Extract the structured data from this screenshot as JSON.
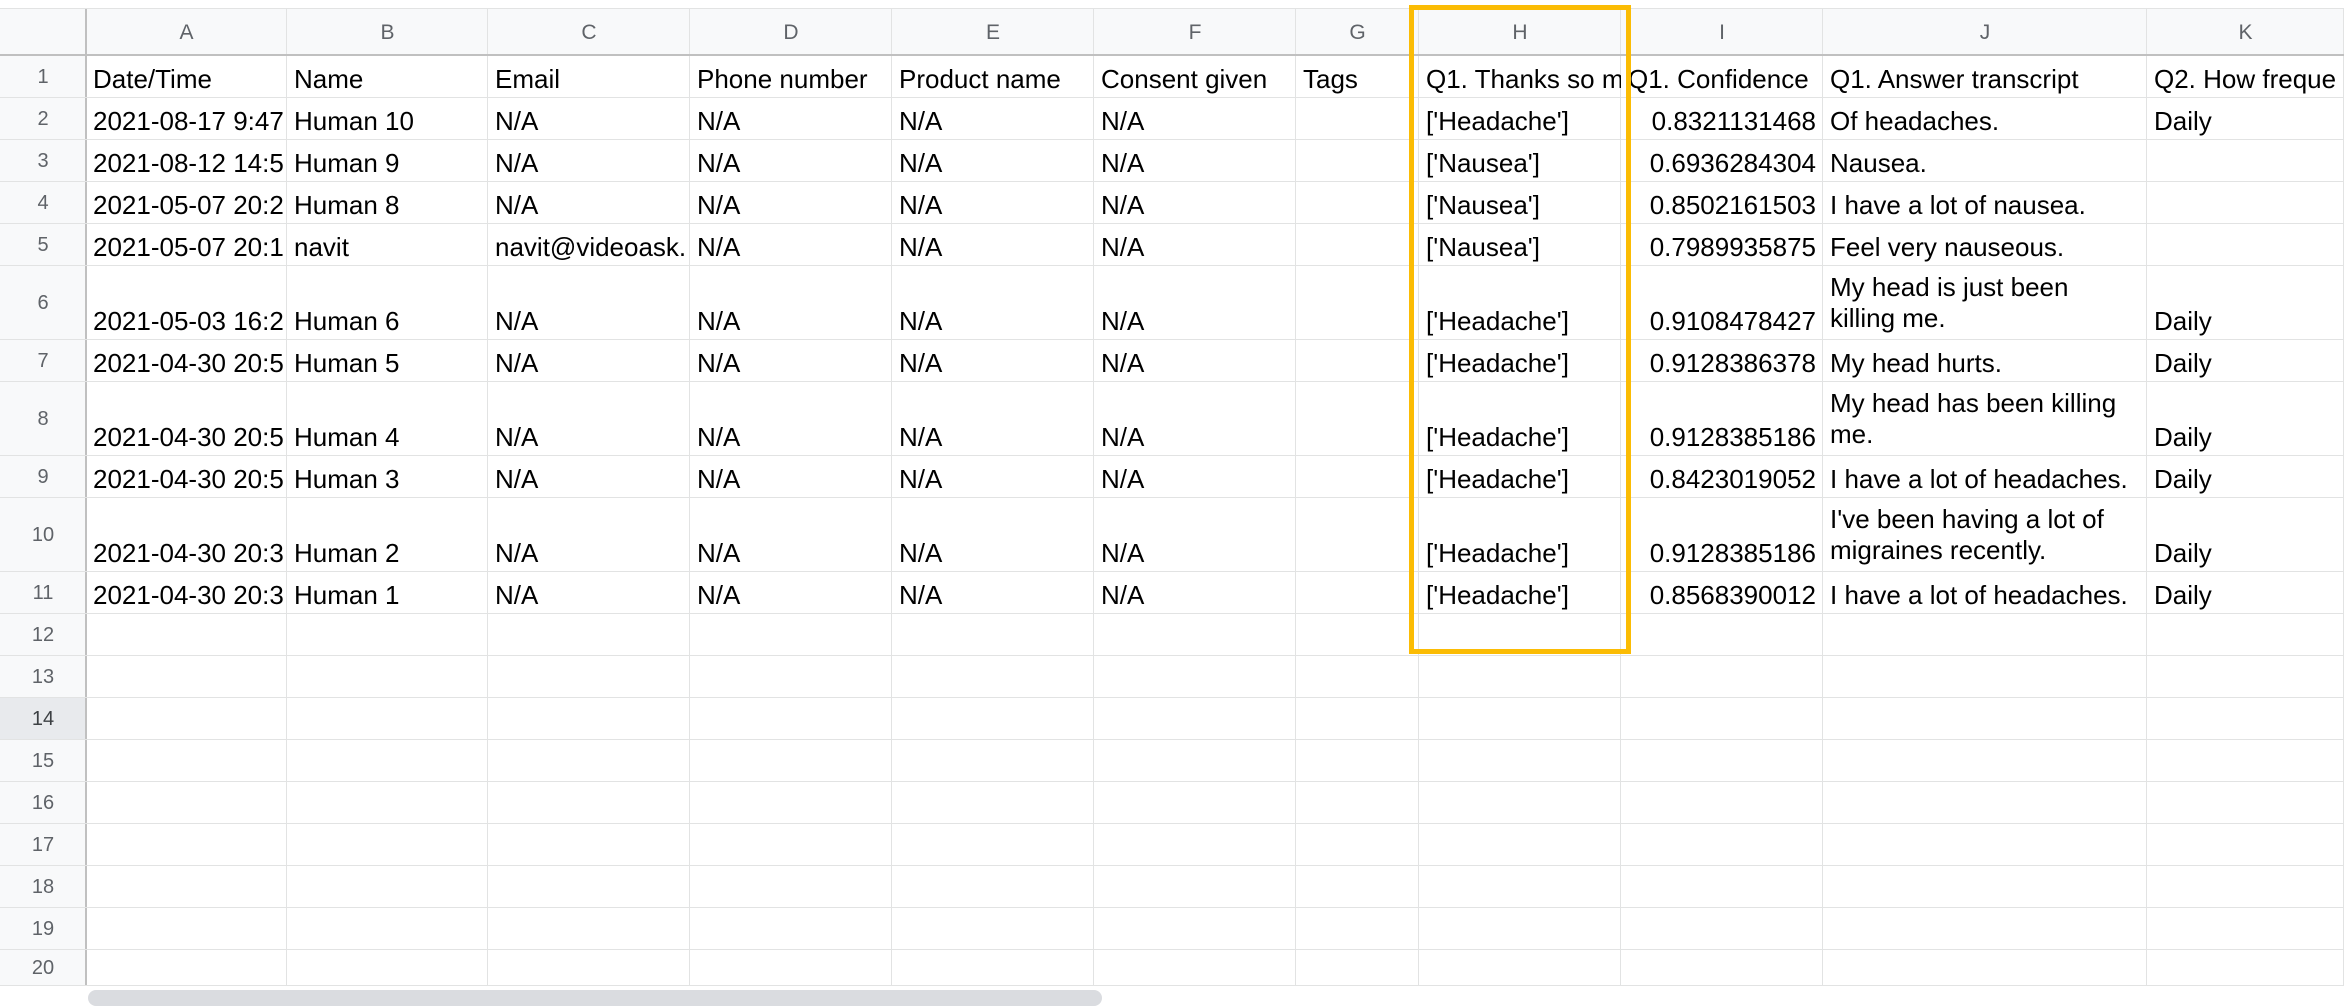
{
  "columns": [
    "A",
    "B",
    "C",
    "D",
    "E",
    "F",
    "G",
    "H",
    "I",
    "J",
    "K"
  ],
  "rows": [
    "1",
    "2",
    "3",
    "4",
    "5",
    "6",
    "7",
    "8",
    "9",
    "10",
    "11",
    "12",
    "13",
    "14",
    "15",
    "16",
    "17",
    "18",
    "19",
    "20"
  ],
  "header_row": {
    "A": "Date/Time",
    "B": "Name",
    "C": "Email",
    "D": "Phone number",
    "E": "Product name",
    "F": "Consent given",
    "G": "Tags",
    "H": "Q1. Thanks so m",
    "I": "Q1. Confidence",
    "J": "Q1. Answer transcript",
    "K": "Q2. How freque"
  },
  "data_rows": [
    {
      "A": "2021-08-17 9:47",
      "B": "Human 10",
      "C": "N/A",
      "D": "N/A",
      "E": "N/A",
      "F": "N/A",
      "G": "",
      "H": "['Headache']",
      "I": "0.8321131468",
      "J": "Of headaches.",
      "K": "Daily"
    },
    {
      "A": "2021-08-12 14:5",
      "B": "Human 9",
      "C": "N/A",
      "D": "N/A",
      "E": "N/A",
      "F": "N/A",
      "G": "",
      "H": "['Nausea']",
      "I": "0.6936284304",
      "J": "Nausea.",
      "K": ""
    },
    {
      "A": "2021-05-07 20:2",
      "B": "Human 8",
      "C": "N/A",
      "D": "N/A",
      "E": "N/A",
      "F": "N/A",
      "G": "",
      "H": "['Nausea']",
      "I": "0.8502161503",
      "J": "I have a lot of nausea.",
      "K": ""
    },
    {
      "A": "2021-05-07 20:1",
      "B": "navit",
      "C": "navit@videoask.",
      "D": "N/A",
      "E": "N/A",
      "F": "N/A",
      "G": "",
      "H": "['Nausea']",
      "I": "0.7989935875",
      "J": "Feel very nauseous.",
      "K": ""
    },
    {
      "A": "2021-05-03 16:2",
      "B": "Human 6",
      "C": "N/A",
      "D": "N/A",
      "E": "N/A",
      "F": "N/A",
      "G": "",
      "H": "['Headache']",
      "I": "0.9108478427",
      "J": "My head is just been killing me.",
      "K": "Daily"
    },
    {
      "A": "2021-04-30 20:5",
      "B": "Human 5",
      "C": "N/A",
      "D": "N/A",
      "E": "N/A",
      "F": "N/A",
      "G": "",
      "H": "['Headache']",
      "I": "0.9128386378",
      "J": "My head hurts.",
      "K": "Daily"
    },
    {
      "A": "2021-04-30 20:5",
      "B": "Human 4",
      "C": "N/A",
      "D": "N/A",
      "E": "N/A",
      "F": "N/A",
      "G": "",
      "H": "['Headache']",
      "I": "0.9128385186",
      "J": "My head has been killing me.",
      "K": "Daily"
    },
    {
      "A": "2021-04-30 20:5",
      "B": "Human 3",
      "C": "N/A",
      "D": "N/A",
      "E": "N/A",
      "F": "N/A",
      "G": "",
      "H": "['Headache']",
      "I": "0.8423019052",
      "J": "I have a lot of headaches.",
      "K": "Daily"
    },
    {
      "A": "2021-04-30 20:3",
      "B": "Human 2",
      "C": "N/A",
      "D": "N/A",
      "E": "N/A",
      "F": "N/A",
      "G": "",
      "H": "['Headache']",
      "I": "0.9128385186",
      "J": "I've been having a lot of migraines recently.",
      "K": "Daily"
    },
    {
      "A": "2021-04-30 20:3",
      "B": "Human 1",
      "C": "N/A",
      "D": "N/A",
      "E": "N/A",
      "F": "N/A",
      "G": "",
      "H": "['Headache']",
      "I": "0.8568390012",
      "J": "I have a lot of headaches.",
      "K": "Daily"
    }
  ],
  "selected_row": "14",
  "highlighted_column": "H",
  "colors": {
    "highlight": "#fbbc04",
    "header_bg": "#f8f9fa",
    "gridline": "#e2e3e3",
    "selected_row_bg": "#e8eaed"
  }
}
